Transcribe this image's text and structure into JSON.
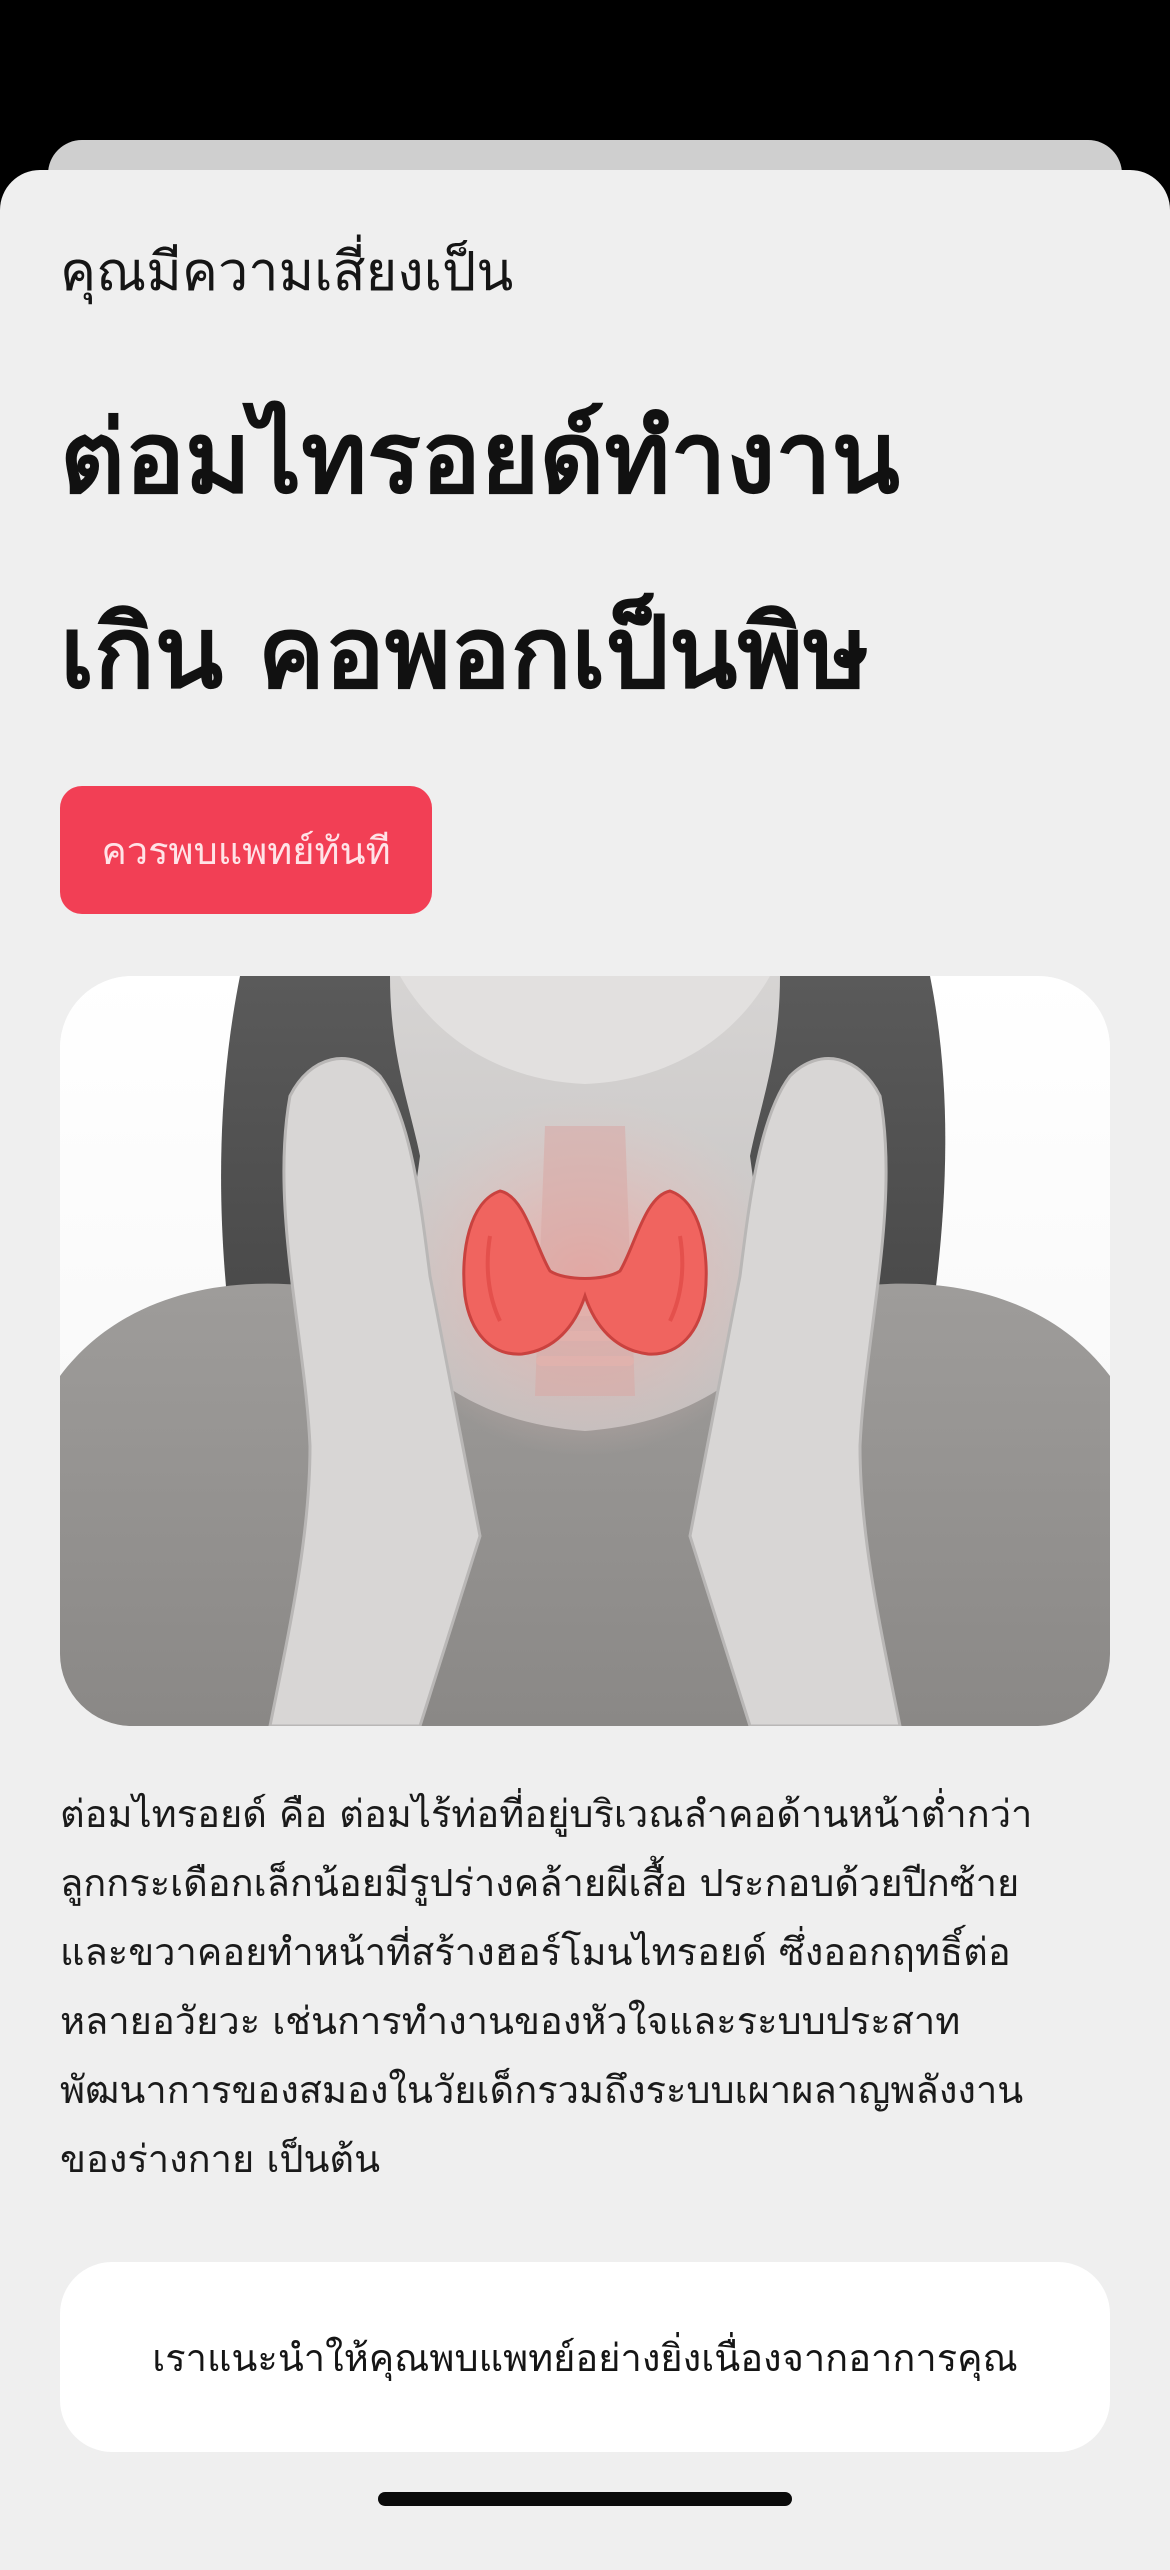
{
  "header": {
    "subtitle": "คุณมีความเสี่ยงเป็น",
    "title_lines": [
      "ต่อมไทรอยด์ทำงาน",
      "เกิน คอพอกเป็นพิษ"
    ]
  },
  "cta": {
    "label": "ควรพบแพทย์ทันที"
  },
  "hero_image": {
    "subject": "woman-neck-thyroid-illustration"
  },
  "description": {
    "lines": [
      "ต่อมไทรอยด์ คือ ต่อมไร้ท่อที่อยู่บริเวณลำคอด้านหน้าต่ำกว่า",
      "ลูกกระเดือกเล็กน้อยมีรูปร่างคล้ายผีเสื้อ ประกอบด้วยปีกซ้าย",
      "และขวาคอยทำหน้าที่สร้างฮอร์โมนไทรอยด์ ซึ่งออกฤทธิ์ต่อ",
      "หลายอวัยวะ เช่นการทำงานของหัวใจและระบบประสาท",
      "พัฒนาการของสมองในวัยเด็กรวมถึงระบบเผาผลาญพลังงาน",
      "ของร่างกาย เป็นต้น"
    ]
  },
  "advice": {
    "text": "เราแนะนำให้คุณพบแพทย์อย่างยิ่งเนื่องจากอาการคุณ"
  },
  "colors": {
    "accent": "#f23f55",
    "sheet": "#efefef",
    "thyroid": "#f0645f"
  }
}
